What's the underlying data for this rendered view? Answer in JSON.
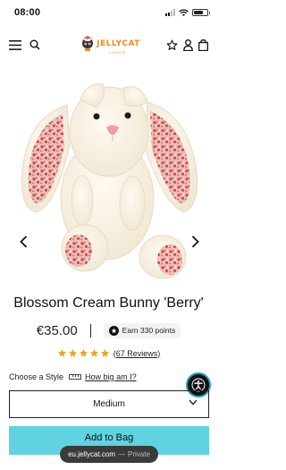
{
  "status_bar": {
    "time": "08:00",
    "icons": [
      "signal-icon",
      "wifi-icon",
      "battery-icon"
    ],
    "battery_level": 0.7
  },
  "header": {
    "logo_text": "JELLYCAT",
    "logo_subtext": "LONDON",
    "icons": [
      "menu-icon",
      "search-icon",
      "star-icon",
      "account-icon",
      "bag-icon"
    ],
    "brand_color": "#f08c1c"
  },
  "product": {
    "image_alt_icon": "bunny-image",
    "title": "Blossom Cream Bunny 'Berry'",
    "price": "€35.00",
    "points_label": "Earn 330 points",
    "rating_stars": 5,
    "star_color": "#f3a11c",
    "reviews_link": "(67 Reviews)"
  },
  "options": {
    "choose_style_label": "Choose a Style",
    "size_link": "How big am I?",
    "selected_size": "Medium"
  },
  "actions": {
    "add_to_bag": "Add to Bag",
    "button_color": "#5fd3e0"
  },
  "browser": {
    "url": "eu.jellycat.com",
    "separator": "—",
    "mode": "Private"
  },
  "accessibility": {
    "icon": "accessibility-icon"
  }
}
